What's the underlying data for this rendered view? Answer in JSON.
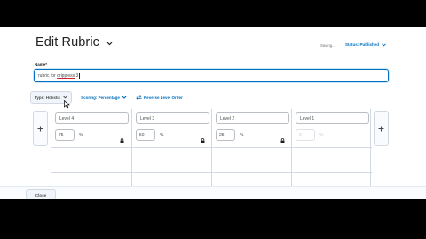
{
  "header": {
    "title": "Edit Rubric",
    "saving_text": "Saving...",
    "status_label": "Status: Published"
  },
  "name_field": {
    "label": "Name*",
    "value_prefix": "rubric for ",
    "value_misspelled": "drippless",
    "value_suffix": " 3"
  },
  "toolbar": {
    "type_label": "Type: Holistic",
    "scoring_label": "Scoring: Percentage",
    "reverse_label": "Reverse Level Order"
  },
  "levels": [
    {
      "name": "Level 4",
      "points": "75",
      "unit": "%",
      "locked": true
    },
    {
      "name": "Level 3",
      "points": "50",
      "unit": "%",
      "locked": true
    },
    {
      "name": "Level 2",
      "points": "25",
      "unit": "%",
      "locked": true
    },
    {
      "name": "Level 1",
      "points": "0",
      "unit": "%",
      "locked": false
    }
  ],
  "footer": {
    "close_label": "Close"
  },
  "colors": {
    "accent": "#006fbf",
    "border": "#d3d9e3",
    "text": "#494c4e"
  },
  "icons": [
    "chevron-down-icon",
    "lock-icon",
    "plus-icon",
    "swap-icon",
    "cursor-icon"
  ]
}
